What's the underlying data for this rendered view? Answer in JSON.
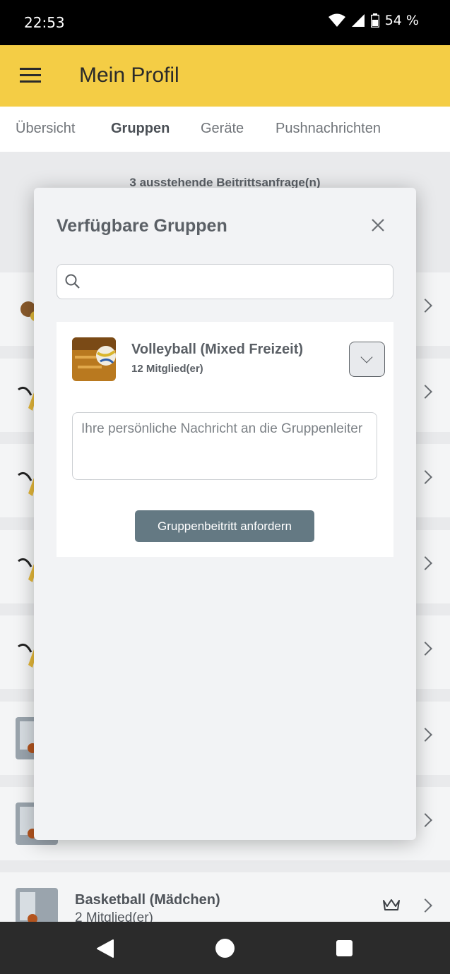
{
  "status_bar": {
    "time": "22:53",
    "battery": "54 %"
  },
  "app_bar": {
    "title": "Mein Profil"
  },
  "tabs": [
    {
      "label": "Übersicht"
    },
    {
      "label": "Gruppen",
      "active": true
    },
    {
      "label": "Geräte"
    },
    {
      "label": "Pushnachrichten"
    }
  ],
  "background": {
    "pending_requests": "3 ausstehende Beitrittsanfrage(n)",
    "last_row": {
      "name": "Basketball (Mädchen)",
      "members": "2 Mitglied(er)"
    }
  },
  "dialog": {
    "title": "Verfügbare Gruppen",
    "search": {
      "placeholder": "",
      "value": ""
    },
    "group": {
      "name": "Volleyball (Mixed Freizeit)",
      "members": "12  Mitglied(er)",
      "message_placeholder": "Ihre persönliche Nachricht an die Gruppenleiter",
      "submit_label": "Gruppenbeitritt anfordern"
    }
  },
  "colors": {
    "app_bar": "#f4cd45",
    "button": "#647983"
  }
}
